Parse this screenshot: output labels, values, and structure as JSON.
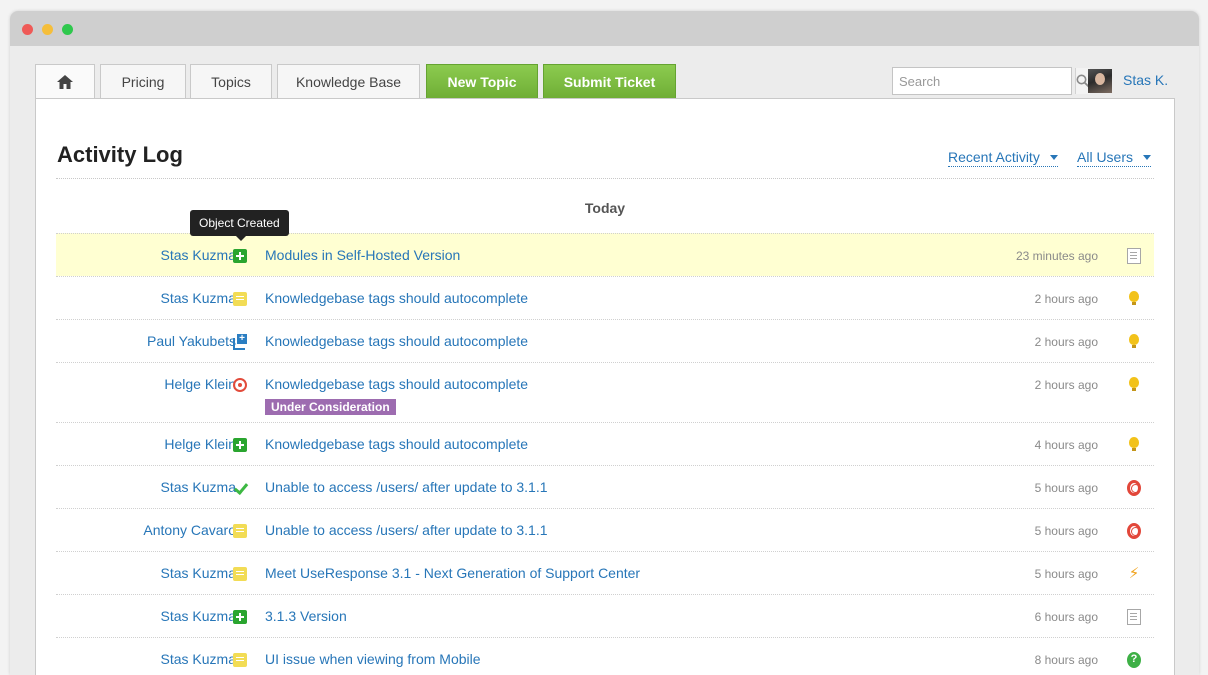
{
  "nav": {
    "tabs": [
      {
        "label": "Pricing"
      },
      {
        "label": "Topics"
      },
      {
        "label": "Knowledge Base"
      }
    ],
    "new_topic_label": "New Topic",
    "submit_ticket_label": "Submit Ticket",
    "search_placeholder": "Search",
    "user_name": "Stas K."
  },
  "page": {
    "title": "Activity Log",
    "filter_recent": "Recent Activity",
    "filter_users": "All Users",
    "day_header": "Today",
    "tooltip": "Object Created"
  },
  "colors": {
    "accent": "#2776b8",
    "green_button": "#7ab93f",
    "highlight_row": "#ffffd2",
    "badge": "#9d6cb0"
  },
  "activities": [
    {
      "user": "Stas Kuzma",
      "action_icon": "object-created-icon",
      "title": "Modules in Self-Hosted Version",
      "time": "23 minutes ago",
      "type_icon": "article-icon",
      "highlight": true
    },
    {
      "user": "Stas Kuzma",
      "action_icon": "comment-icon",
      "title": "Knowledgebase tags should autocomplete",
      "time": "2 hours ago",
      "type_icon": "idea-icon"
    },
    {
      "user": "Paul Yakubets",
      "action_icon": "duplicate-icon",
      "title": "Knowledgebase tags should autocomplete",
      "time": "2 hours ago",
      "type_icon": "idea-icon"
    },
    {
      "user": "Helge Klein",
      "action_icon": "status-change-icon",
      "title": "Knowledgebase tags should autocomplete",
      "badge": "Under Consideration",
      "time": "2 hours ago",
      "type_icon": "idea-icon"
    },
    {
      "user": "Helge Klein",
      "action_icon": "object-created-icon",
      "title": "Knowledgebase tags should autocomplete",
      "time": "4 hours ago",
      "type_icon": "idea-icon"
    },
    {
      "user": "Stas Kuzma",
      "action_icon": "checkmark-icon",
      "title": "Unable to access /users/ after update to 3.1.1",
      "time": "5 hours ago",
      "type_icon": "lifebuoy-icon"
    },
    {
      "user": "Antony Cavaro",
      "action_icon": "comment-icon",
      "title": "Unable to access /users/ after update to 3.1.1",
      "time": "5 hours ago",
      "type_icon": "lifebuoy-icon"
    },
    {
      "user": "Stas Kuzma",
      "action_icon": "comment-icon",
      "title": "Meet UseResponse 3.1 - Next Generation of Support Center",
      "time": "5 hours ago",
      "type_icon": "lightning-icon"
    },
    {
      "user": "Stas Kuzma",
      "action_icon": "object-created-icon",
      "title": "3.1.3 Version",
      "time": "6 hours ago",
      "type_icon": "article-icon"
    },
    {
      "user": "Stas Kuzma",
      "action_icon": "comment-icon",
      "title": "UI issue when viewing from Mobile",
      "time": "8 hours ago",
      "type_icon": "question-icon"
    }
  ]
}
